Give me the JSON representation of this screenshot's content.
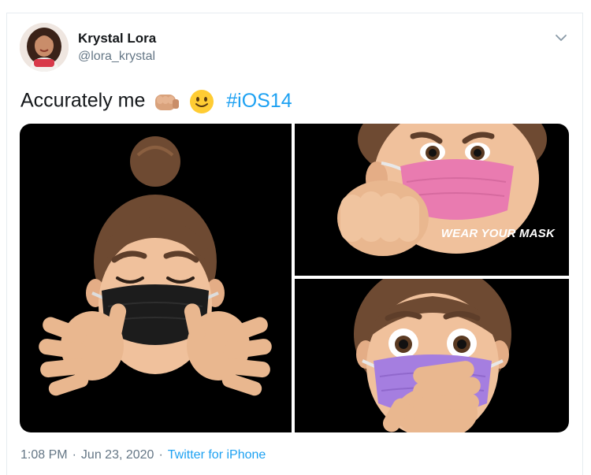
{
  "author": {
    "name": "Krystal Lora",
    "handle": "@lora_krystal",
    "avatar_icon": "profile-photo"
  },
  "tweet": {
    "text": "Accurately me",
    "emojis": [
      "oncoming-fist-emoji",
      "slightly-smiling-face-emoji"
    ],
    "hashtag": "#iOS14"
  },
  "media": {
    "panels": [
      {
        "name": "memoji-black-mask-waving",
        "mask_color": "#1c1c1c"
      },
      {
        "name": "memoji-pink-mask-fist",
        "mask_color": "#e97bb0",
        "caption": "WEAR YOUR MASK"
      },
      {
        "name": "memoji-purple-mask-surprised",
        "mask_color": "#a57ee0"
      }
    ]
  },
  "meta": {
    "time": "1:08 PM",
    "date": "Jun 23, 2020",
    "source": "Twitter for iPhone",
    "separator": "·"
  },
  "colors": {
    "link": "#1da1f2",
    "secondary_text": "#657786",
    "border": "#e6ecf0"
  }
}
